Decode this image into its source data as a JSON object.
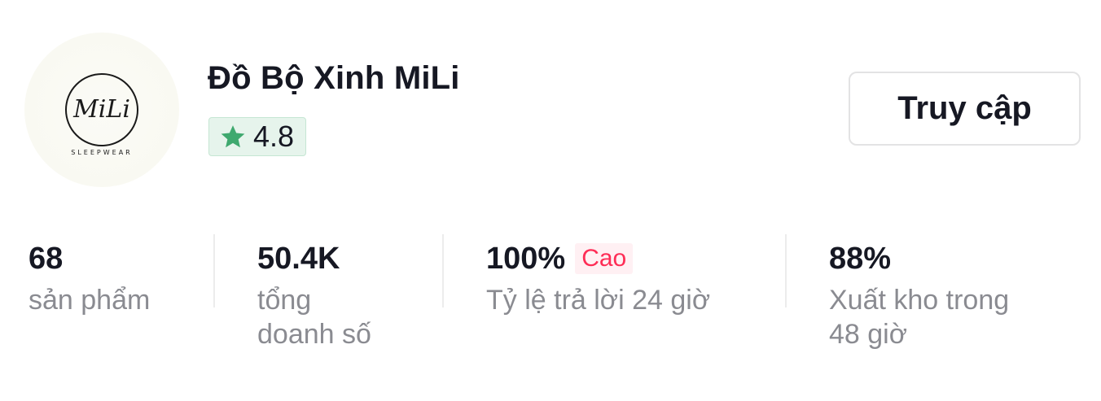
{
  "shop": {
    "logo_text": "MiLi",
    "logo_subtext": "SLEEPWEAR",
    "name": "Đồ Bộ Xinh MiLi",
    "rating": "4.8",
    "visit_button": "Truy cập"
  },
  "stats": [
    {
      "value": "68",
      "label": "sản phẩm"
    },
    {
      "value": "50.4K",
      "label_line1": "tổng",
      "label_line2": "doanh số"
    },
    {
      "value": "100%",
      "tag": "Cao",
      "label": "Tỷ lệ trả lời 24 giờ"
    },
    {
      "value": "88%",
      "label_line1": "Xuất kho trong",
      "label_line2": "48 giờ"
    }
  ],
  "colors": {
    "rating_badge_bg": "#e6f4ec",
    "star": "#3fa96f",
    "tag_high_text": "#fe2c55",
    "label_gray": "#8a8b91"
  },
  "icons": {
    "rating": "star-icon"
  }
}
